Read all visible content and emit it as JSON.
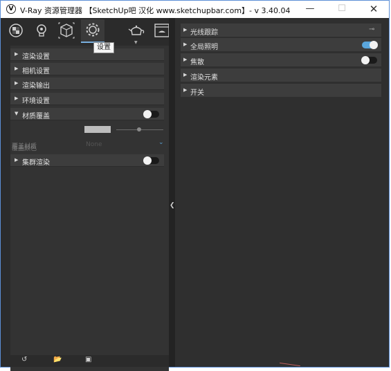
{
  "window": {
    "title": "V-Ray 资源管理器 【SketchUp吧 汉化 www.sketchupbar.com】- v 3.40.04",
    "app_icon_glyph": "V",
    "minimize_glyph": "—",
    "maximize_glyph": "☐",
    "close_glyph": "✕"
  },
  "toolbar": {
    "icons": [
      "material-icon",
      "light-icon",
      "geometry-icon",
      "settings-icon",
      "teapot-render-icon",
      "frame-buffer-icon"
    ],
    "active": "settings-icon",
    "tooltip": "设置"
  },
  "left_panel": {
    "rollouts": [
      {
        "label": "渲染设置",
        "expanded": false
      },
      {
        "label": "相机设置",
        "expanded": false
      },
      {
        "label": "渲染输出",
        "expanded": false
      },
      {
        "label": "环境设置",
        "expanded": false
      },
      {
        "label": "材质覆盖",
        "expanded": true,
        "toggle": false
      }
    ],
    "override_color_label": "覆盖颜色",
    "override_material_label": "覆盖材质",
    "override_material_value": "None",
    "swarm_label": "集群渲染",
    "swarm_toggle": false,
    "bottom_icons": [
      "undo-icon",
      "open-folder-icon",
      "save-icon"
    ]
  },
  "right_panel": {
    "rollouts": [
      {
        "label": "光线跟踪",
        "pinned": true
      },
      {
        "label": "全局照明",
        "toggle": true
      },
      {
        "label": "焦散",
        "toggle": false
      },
      {
        "label": "渲染元素"
      },
      {
        "label": "开关"
      }
    ]
  },
  "colors": {
    "accent": "#5aa6dc",
    "panel_bg": "#2b2b2b",
    "rollout_bg": "#3d3d3d"
  }
}
